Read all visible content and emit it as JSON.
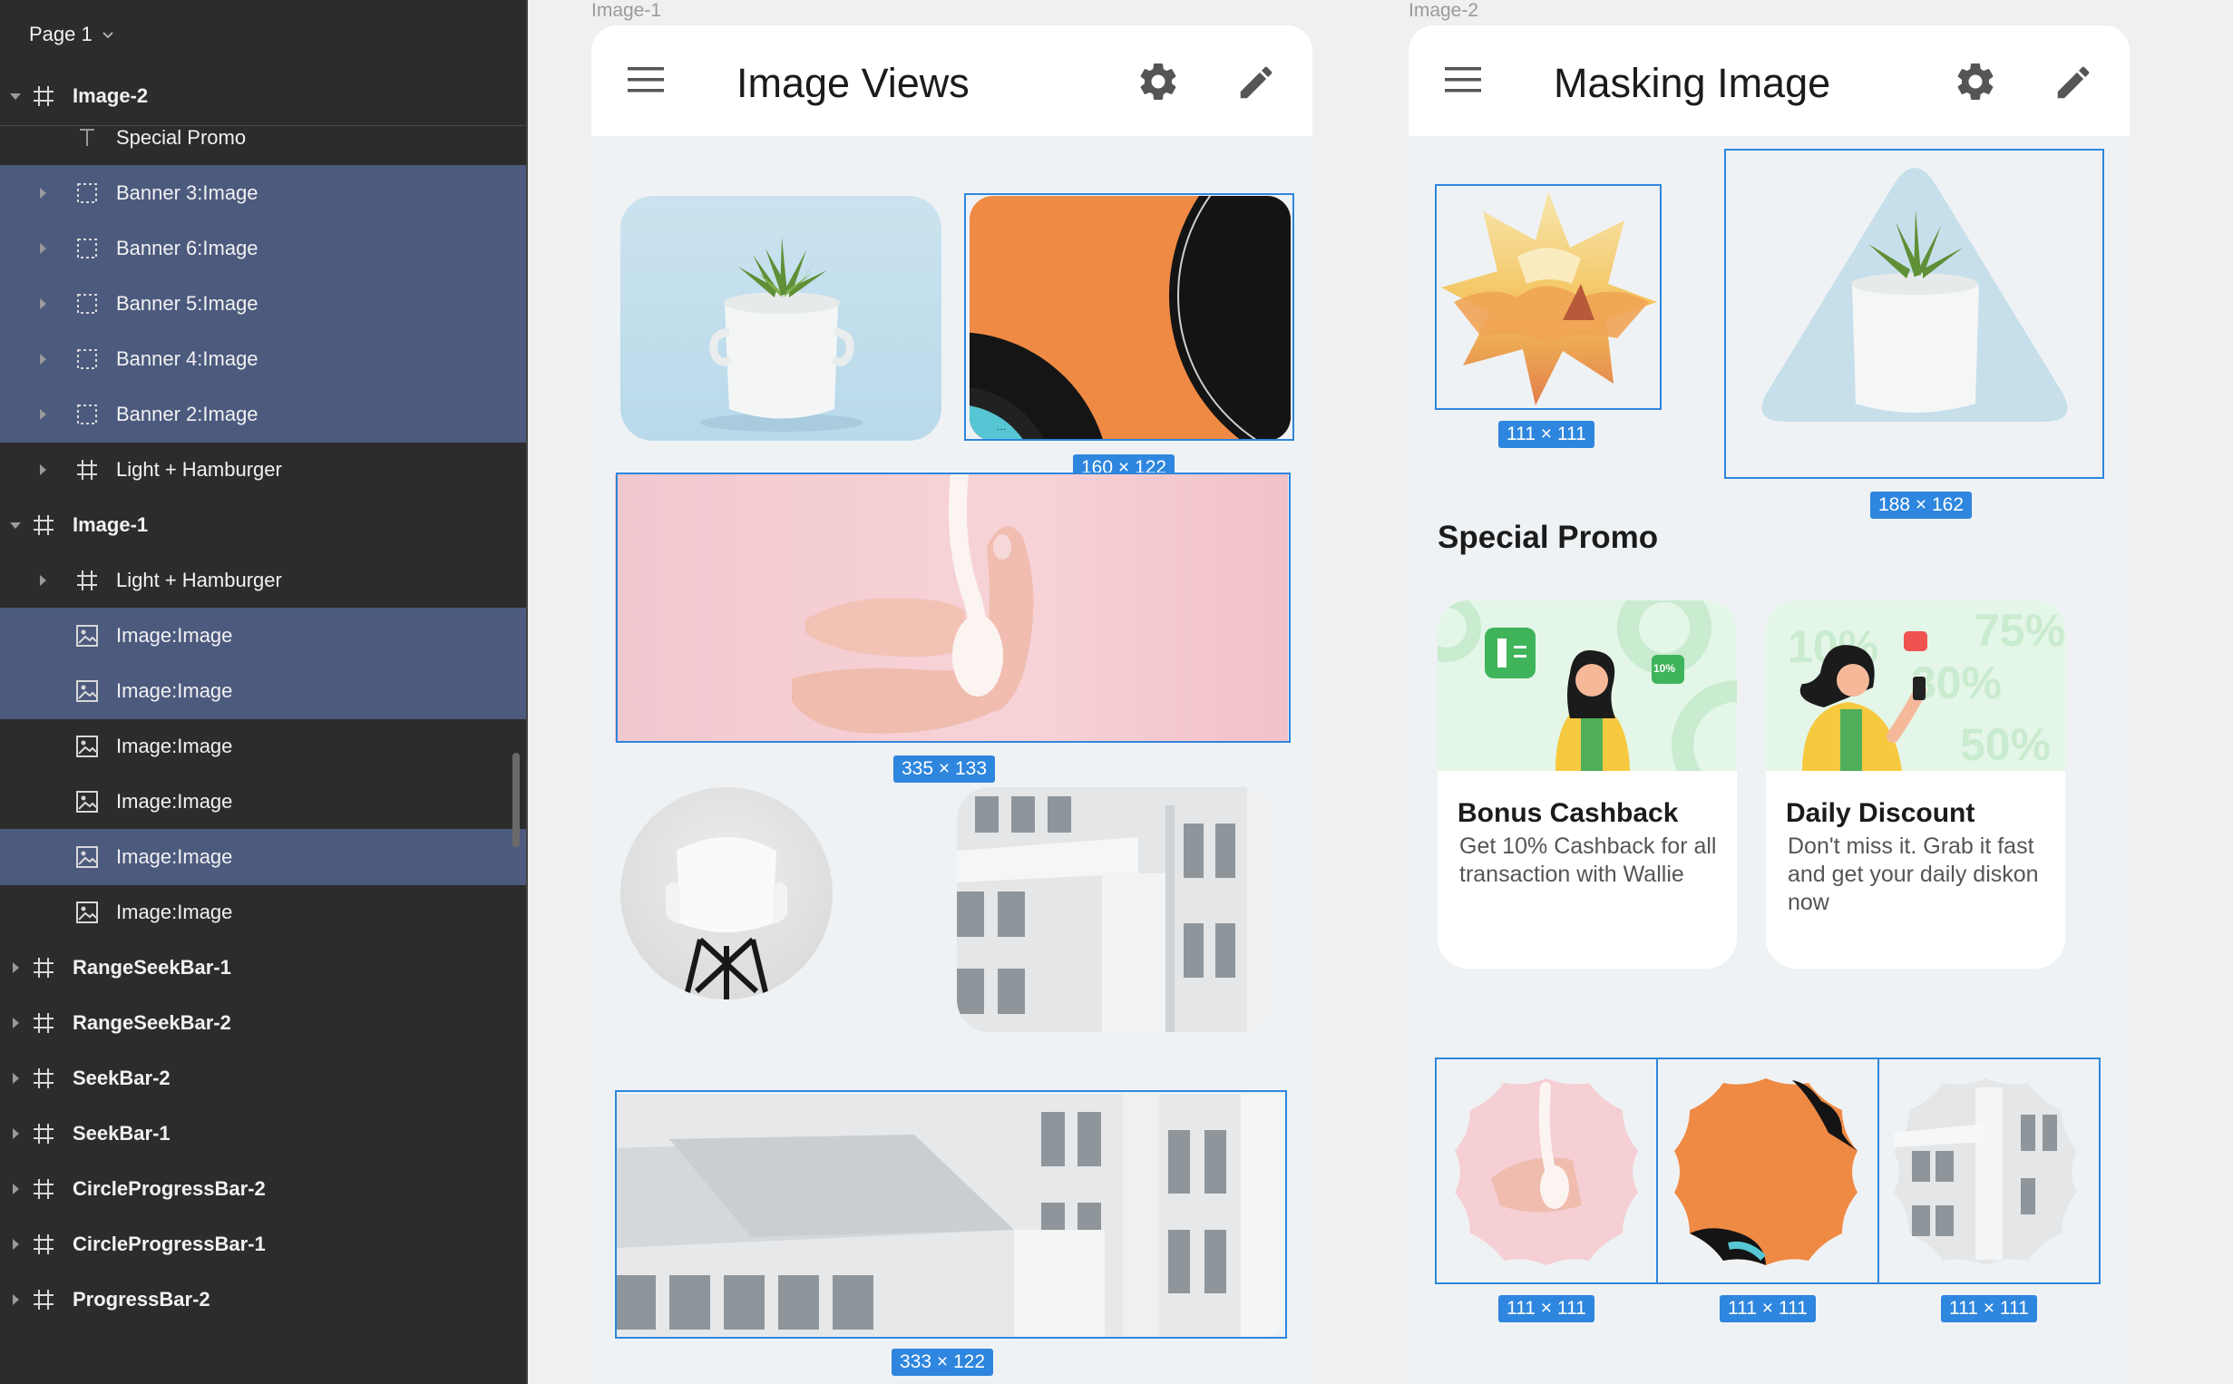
{
  "sidebar": {
    "page_label": "Page 1",
    "layers": [
      {
        "label": "Image-2",
        "level": "top",
        "icon": "frame-icon",
        "expanded": true,
        "selected": false
      },
      {
        "label": "Special Promo",
        "level": "child",
        "icon": "text-icon",
        "expanded": null,
        "selected": false
      },
      {
        "label": "Banner 3:Image",
        "level": "child",
        "icon": "dashed-frame-icon",
        "expanded": false,
        "selected": true
      },
      {
        "label": "Banner 6:Image",
        "level": "child",
        "icon": "dashed-frame-icon",
        "expanded": false,
        "selected": true
      },
      {
        "label": "Banner 5:Image",
        "level": "child",
        "icon": "dashed-frame-icon",
        "expanded": false,
        "selected": true
      },
      {
        "label": "Banner 4:Image",
        "level": "child",
        "icon": "dashed-frame-icon",
        "expanded": false,
        "selected": true
      },
      {
        "label": "Banner 2:Image",
        "level": "child",
        "icon": "dashed-frame-icon",
        "expanded": false,
        "selected": true
      },
      {
        "label": "Light + Hamburger",
        "level": "child",
        "icon": "frame-icon",
        "expanded": false,
        "selected": false
      },
      {
        "label": "Image-1",
        "level": "top",
        "icon": "frame-icon",
        "expanded": true,
        "selected": false
      },
      {
        "label": "Light + Hamburger",
        "level": "child",
        "icon": "frame-icon",
        "expanded": false,
        "selected": false
      },
      {
        "label": "Image:Image",
        "level": "child",
        "icon": "image-icon",
        "expanded": null,
        "selected": true
      },
      {
        "label": "Image:Image",
        "level": "child",
        "icon": "image-icon",
        "expanded": null,
        "selected": true
      },
      {
        "label": "Image:Image",
        "level": "child",
        "icon": "image-icon",
        "expanded": null,
        "selected": false
      },
      {
        "label": "Image:Image",
        "level": "child",
        "icon": "image-icon",
        "expanded": null,
        "selected": false
      },
      {
        "label": "Image:Image",
        "level": "child",
        "icon": "image-icon",
        "expanded": null,
        "selected": true
      },
      {
        "label": "Image:Image",
        "level": "child",
        "icon": "image-icon",
        "expanded": null,
        "selected": false
      },
      {
        "label": "RangeSeekBar-1",
        "level": "top",
        "icon": "frame-icon",
        "expanded": false,
        "selected": false
      },
      {
        "label": "RangeSeekBar-2",
        "level": "top",
        "icon": "frame-icon",
        "expanded": false,
        "selected": false
      },
      {
        "label": "SeekBar-2",
        "level": "top",
        "icon": "frame-icon",
        "expanded": false,
        "selected": false
      },
      {
        "label": "SeekBar-1",
        "level": "top",
        "icon": "frame-icon",
        "expanded": false,
        "selected": false
      },
      {
        "label": "CircleProgressBar-2",
        "level": "top",
        "icon": "frame-icon",
        "expanded": false,
        "selected": false
      },
      {
        "label": "CircleProgressBar-1",
        "level": "top",
        "icon": "frame-icon",
        "expanded": false,
        "selected": false
      },
      {
        "label": "ProgressBar-2",
        "level": "top",
        "icon": "frame-icon",
        "expanded": false,
        "selected": false
      }
    ]
  },
  "frame1": {
    "label": "Image-1",
    "title": "Image Views",
    "dims": {
      "vinyl": "160 × 122",
      "hand": "335 × 133",
      "building": "333 × 122"
    }
  },
  "frame2": {
    "label": "Image-2",
    "title": "Masking Image",
    "dims": {
      "star": "111 × 111",
      "triangle": "188 × 162",
      "wave1": "111 × 111",
      "wave2": "111 × 111",
      "wave3": "111 × 111"
    },
    "promo_heading": "Special Promo",
    "promos": [
      {
        "title": "Bonus Cashback",
        "desc": "Get 10% Cashback for all transaction with Wallie",
        "badge": "10%"
      },
      {
        "title": "Daily Discount",
        "desc": "Don't miss it. Grab it fast and get your daily diskon now",
        "bg_numbers": [
          "10%",
          "75%",
          "30%",
          "50%"
        ]
      }
    ]
  },
  "colors": {
    "selection_blue": "#2e86de",
    "layer_selected": "#4c5a7e",
    "sidebar_bg": "#2c2c2c",
    "promo_green": "#e4f6e7"
  },
  "icons": {
    "menu": "hamburger-menu-icon",
    "settings": "gear-icon",
    "edit": "pencil-icon"
  }
}
